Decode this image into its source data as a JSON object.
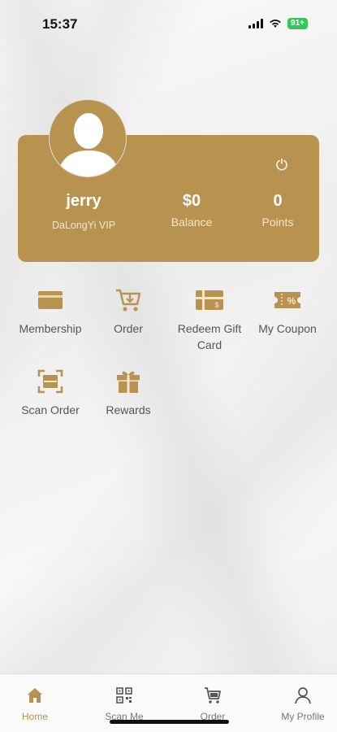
{
  "status_bar": {
    "time": "15:37",
    "battery": "91+"
  },
  "profile": {
    "name": "jerry",
    "level": "DaLongYi VIP",
    "balance_value": "$0",
    "balance_label": "Balance",
    "points_value": "0",
    "points_label": "Points"
  },
  "menu": {
    "membership": "Membership",
    "order": "Order",
    "redeem_line1": "Redeem Gift",
    "redeem_line2": "Card",
    "coupon": "My Coupon",
    "scan_order": "Scan Order",
    "rewards": "Rewards"
  },
  "tabbar": {
    "home": "Home",
    "scan_me": "Scan Me",
    "order": "Order",
    "my_profile": "My Profile"
  },
  "colors": {
    "accent": "#b8924f",
    "icon": "#b8924f"
  },
  "icons": [
    "power-icon",
    "membership-card-icon",
    "cart-icon",
    "gift-card-icon",
    "coupon-icon",
    "scan-icon",
    "gift-icon",
    "home-icon",
    "qr-icon",
    "profile-icon"
  ]
}
